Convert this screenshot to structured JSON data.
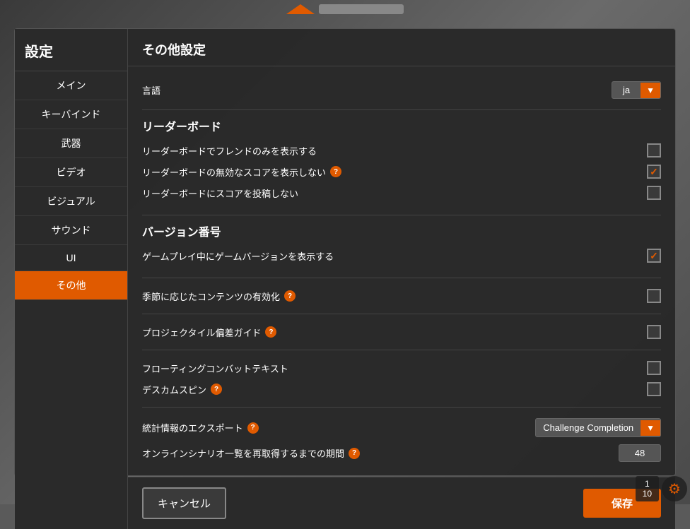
{
  "background": {
    "color": "#5a6a6a"
  },
  "sidebar": {
    "header_label": "設定",
    "items": [
      {
        "id": "main",
        "label": "メイン",
        "active": false
      },
      {
        "id": "keybind",
        "label": "キーバインド",
        "active": false
      },
      {
        "id": "weapons",
        "label": "武器",
        "active": false
      },
      {
        "id": "video",
        "label": "ビデオ",
        "active": false
      },
      {
        "id": "visual",
        "label": "ビジュアル",
        "active": false
      },
      {
        "id": "sound",
        "label": "サウンド",
        "active": false
      },
      {
        "id": "ui",
        "label": "UI",
        "active": false
      },
      {
        "id": "other",
        "label": "その他",
        "active": true
      }
    ]
  },
  "content": {
    "title": "その他設定",
    "sections": {
      "language": {
        "label": "言語",
        "value": "ja"
      },
      "leaderboard": {
        "title": "リーダーボード",
        "rows": [
          {
            "label": "リーダーボードでフレンドのみを表示する",
            "checked": false,
            "has_help": false
          },
          {
            "label": "リーダーボードの無効なスコアを表示しない",
            "checked": true,
            "has_help": true
          },
          {
            "label": "リーダーボードにスコアを投稿しない",
            "checked": false,
            "has_help": false
          }
        ]
      },
      "version": {
        "title": "バージョン番号",
        "rows": [
          {
            "label": "ゲームプレイ中にゲームバージョンを表示する",
            "checked": true,
            "has_help": false
          }
        ]
      },
      "seasonal": {
        "label": "季節に応じたコンテンツの有効化",
        "checked": false,
        "has_help": true
      },
      "projectile": {
        "label": "プロジェクタイル偏差ガイド",
        "checked": false,
        "has_help": true
      },
      "floating_combat": {
        "label": "フローティングコンバットテキスト",
        "checked": false,
        "has_help": false
      },
      "deskcam": {
        "label": "デスカムスピン",
        "checked": false,
        "has_help": true
      },
      "stats_export": {
        "label": "統計情報のエクスポート",
        "has_help": true,
        "dropdown_value": "Challenge Completion"
      },
      "online_scenario": {
        "label": "オンラインシナリオ一覧を再取得するまでの期間",
        "has_help": true,
        "value": "48"
      }
    }
  },
  "footer": {
    "cancel_label": "キャンセル",
    "save_label": "保存"
  },
  "hud": {
    "counter": "1\n10",
    "gear": "⚙"
  }
}
